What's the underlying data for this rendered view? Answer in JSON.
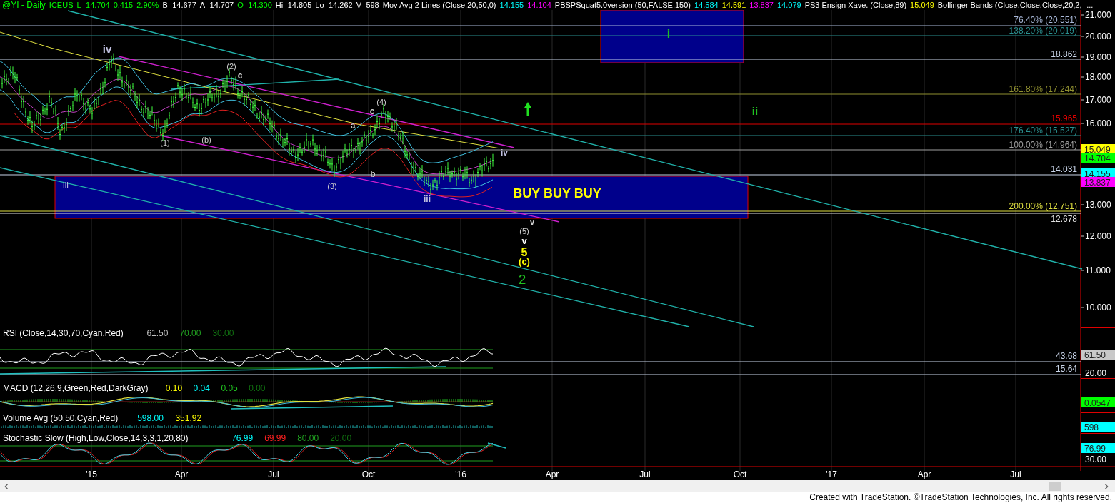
{
  "header": {
    "items": [
      {
        "text": "@YI - Daily",
        "color": "#00ff00"
      },
      {
        "text": "ICEUS",
        "color": "#00ff00"
      },
      {
        "text": "L=14.704",
        "color": "#00ff00"
      },
      {
        "text": "0.415",
        "color": "#00ff00"
      },
      {
        "text": "2.90%",
        "color": "#00ff00"
      },
      {
        "text": "B=14.677",
        "color": "#ffffff"
      },
      {
        "text": "A=14.707",
        "color": "#ffffff"
      },
      {
        "text": "O=14.300",
        "color": "#00ff00"
      },
      {
        "text": "Hi=14.805",
        "color": "#ffffff"
      },
      {
        "text": "Lo=14.262",
        "color": "#ffffff"
      },
      {
        "text": "V=598",
        "color": "#ffffff"
      },
      {
        "text": "Mov Avg 2 Lines (Close,20,50,0)",
        "color": "#ffffff"
      },
      {
        "text": "14.155",
        "color": "#00ffff"
      },
      {
        "text": "14.104",
        "color": "#ff00ff"
      },
      {
        "text": "PBSPSquat5.0version (50,FALSE,150)",
        "color": "#ffffff"
      },
      {
        "text": "14.584",
        "color": "#00ffff"
      },
      {
        "text": "14.591",
        "color": "#ffff00"
      },
      {
        "text": "13.837",
        "color": "#ff00ff"
      },
      {
        "text": "14.079",
        "color": "#00ffff"
      },
      {
        "text": "PS3 Ensign Xave. (Close,89)",
        "color": "#ffffff"
      },
      {
        "text": "15.049",
        "color": "#ffff00"
      },
      {
        "text": "Bollinger Bands (Close,Close,Close,20,2,- ...",
        "color": "#ffffff"
      }
    ]
  },
  "price_pane": {
    "axis_labels": [
      "21.000",
      "20.000",
      "19.000",
      "18.000",
      "17.000",
      "16.000",
      "13.000",
      "12.000",
      "11.000",
      "10.000"
    ],
    "badges": [
      {
        "text": "15.049",
        "color": "#ffff00"
      },
      {
        "text": "14.704",
        "color": "#00ff00"
      },
      {
        "text": "14.155",
        "color": "#00ffff"
      },
      {
        "text": "13.837",
        "color": "#ff00ff"
      }
    ],
    "level_labels": [
      {
        "text": "76.40% (20.551)",
        "color": "#a8b8d8"
      },
      {
        "text": "138.20% (20.019)",
        "color": "#2a9090"
      },
      {
        "text": "18.862",
        "color": "#c8d4e8"
      },
      {
        "text": "161.80% (17.244)",
        "color": "#909030"
      },
      {
        "text": "15.965",
        "color": "#e00000"
      },
      {
        "text": "176.40% (15.527)",
        "color": "#2a9090"
      },
      {
        "text": "100.00% (14.964)",
        "color": "#a0a0a0"
      },
      {
        "text": "14.031",
        "color": "#c8d4e8"
      },
      {
        "text": "200.00% (12.751)",
        "color": "#e0e040"
      },
      {
        "text": "12.678",
        "color": "#e0e0e0"
      }
    ],
    "wave_labels": [
      {
        "text": "iv",
        "color": "#c0c0e0"
      },
      {
        "text": "(2)",
        "color": "#d0d0d0"
      },
      {
        "text": "c",
        "color": "#d0d0d0"
      },
      {
        "text": "(1)",
        "color": "#d0d0d0"
      },
      {
        "text": "(b)",
        "color": "#d0d0d0"
      },
      {
        "text": "iii",
        "color": "#c0c0e0"
      },
      {
        "text": "(3)",
        "color": "#d0d0d0"
      },
      {
        "text": "a",
        "color": "#d0d0d0"
      },
      {
        "text": "b",
        "color": "#d0d0d0"
      },
      {
        "text": "(4)",
        "color": "#d0d0d0"
      },
      {
        "text": "c",
        "color": "#d0d0d0"
      },
      {
        "text": "iii",
        "color": "#c0c0e0"
      },
      {
        "text": "iv",
        "color": "#c0c0e0"
      },
      {
        "text": "v",
        "color": "#d0d0d0"
      },
      {
        "text": "(5)",
        "color": "#d0d0d0"
      },
      {
        "text": "v",
        "color": "#ffffff"
      },
      {
        "text": "5",
        "color": "#ffff00"
      },
      {
        "text": "(c)",
        "color": "#ffff00"
      },
      {
        "text": "2",
        "color": "#20c020"
      },
      {
        "text": "i",
        "color": "#20c020"
      },
      {
        "text": "ii",
        "color": "#20c020"
      }
    ],
    "zone_label": "BUY BUY BUY"
  },
  "indicators": [
    {
      "kind": "rsi",
      "title_items": [
        {
          "text": "RSI (Close,14,30,70,Cyan,Red)",
          "color": "#ffffff"
        },
        {
          "text": "61.50",
          "color": "#c0c0c0"
        },
        {
          "text": "70.00",
          "color": "#20a020"
        },
        {
          "text": "30.00",
          "color": "#107010"
        }
      ],
      "line_labels": [
        "43.68",
        "15.64"
      ],
      "axis_labels": [
        "20.00"
      ],
      "badge": {
        "text": "61.50",
        "color": "#c8c8c8"
      }
    },
    {
      "kind": "macd",
      "title_items": [
        {
          "text": "MACD (12,26,9,Green,Red,DarkGray)",
          "color": "#ffffff"
        },
        {
          "text": "0.10",
          "color": "#ffff00"
        },
        {
          "text": "0.04",
          "color": "#00ffff"
        },
        {
          "text": "0.05",
          "color": "#20c020"
        },
        {
          "text": "0.00",
          "color": "#107010"
        }
      ],
      "badge": {
        "text": "0.0547",
        "color": "#00ff00"
      }
    },
    {
      "kind": "volume",
      "title_items": [
        {
          "text": "Volume Avg (50,50,Cyan,Red)",
          "color": "#ffffff"
        },
        {
          "text": "598.00",
          "color": "#00ffff"
        },
        {
          "text": "351.92",
          "color": "#ffff00"
        }
      ],
      "badge": {
        "text": "598",
        "color": "#00ffff"
      }
    },
    {
      "kind": "stochastic",
      "title_items": [
        {
          "text": "Stochastic Slow (High,Low,Close,14,3,3,1,20,80)",
          "color": "#ffffff"
        },
        {
          "text": "76.99",
          "color": "#00ffff"
        },
        {
          "text": "69.99",
          "color": "#ff2020"
        },
        {
          "text": "80.00",
          "color": "#20a020"
        },
        {
          "text": "20.00",
          "color": "#107010"
        }
      ],
      "axis_labels": [
        "30.00"
      ],
      "badge": {
        "text": "76.99",
        "color": "#00ffff"
      }
    }
  ],
  "x_axis": {
    "labels": [
      "'15",
      "Apr",
      "Jul",
      "Oct",
      "'16",
      "Apr",
      "Jul",
      "Oct",
      "'17",
      "Apr",
      "Jul"
    ]
  },
  "footer": "Created with TradeStation. ©TradeStation Technologies, Inc. All rights reserved."
}
